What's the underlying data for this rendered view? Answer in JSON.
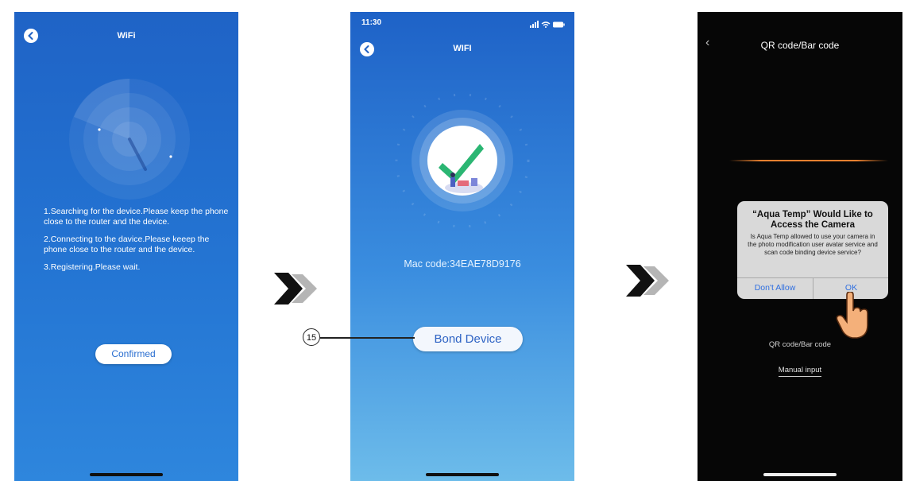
{
  "screen1": {
    "title": "WiFi",
    "steps": [
      "1.Searching for the device.Please keep the phone close to the router and the device.",
      "2.Connecting to the davice.Please keeep the phone close to the router and the device.",
      "3.Registering.Please wait."
    ],
    "confirm_label": "Confirmed"
  },
  "screen2": {
    "status_time": "11:30",
    "title": "WIFI",
    "mac_code": "Mac code:34EAE78D9176",
    "bond_label": "Bond Device"
  },
  "callout": {
    "number": "15"
  },
  "screen3": {
    "title": "QR code/Bar code",
    "dialog": {
      "title": "“Aqua Temp” Would Like to Access the Camera",
      "message": "Is Aqua Temp allowed to use your camera in the photo modification user avatar service and scan code binding device service?",
      "deny_label": "Don't Allow",
      "ok_label": "OK"
    },
    "qr_label": "QR code/Bar code",
    "manual_label": "Manual input"
  },
  "colors": {
    "blue_bg": "#2475d3",
    "check_green": "#2bb673",
    "accent_line": "#e8802f",
    "dialog_button": "#2f6fe0"
  },
  "icons": [
    "back-icon",
    "radar-icon",
    "checkmark-icon",
    "signal-icon",
    "wifi-icon",
    "battery-icon",
    "chevron-next-icon",
    "pointing-hand-icon"
  ]
}
